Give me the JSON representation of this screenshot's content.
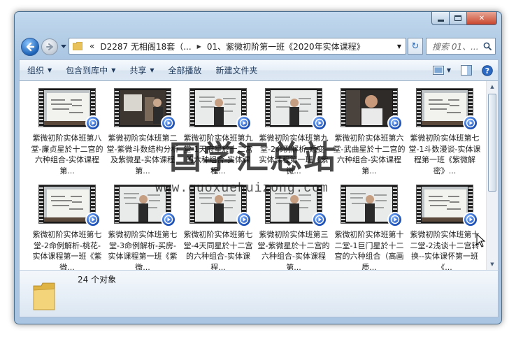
{
  "window": {
    "caption": {
      "minimize": "",
      "maximize": "",
      "close": "✕"
    }
  },
  "nav": {
    "breadcrumbs": [
      {
        "label": "«"
      },
      {
        "label": "D2287 无相阁18套（..."
      },
      {
        "label": "01、紫微初阶第一班《2020年实体课程》"
      }
    ],
    "search_placeholder": "搜索 01、..."
  },
  "toolbar": {
    "organize": "组织",
    "include_in_library": "包含到库中",
    "share": "共享",
    "play_all": "全部播放",
    "new_folder": "新建文件夹"
  },
  "files": [
    {
      "name": "紫微初阶实体班第八堂-廉贞星於十二宫的六种组合-实体课程第...",
      "scene": "board"
    },
    {
      "name": "紫微初阶实体班第二堂-紫微斗数结构分析及紫微星-实体课程第...",
      "scene": "room"
    },
    {
      "name": "紫微初阶实体班第九堂-1天府星於十二宫的六种组合-实体课程...",
      "scene": "board-man"
    },
    {
      "name": "紫微初阶实体班第九堂-2命例解析-婚变-实体课程第一班《紫微...",
      "scene": "board-man"
    },
    {
      "name": "紫微初阶实体班第六堂-武曲星於十二宫的六种组合-实体课程第...",
      "scene": "portrait"
    },
    {
      "name": "紫微初阶实体班第七堂-1斗数漫谈-实体课程第一班《紫微解密》...",
      "scene": "board"
    },
    {
      "name": "紫微初阶实体班第七堂-2命例解析-桃花-实体课程第一班《紫微...",
      "scene": "board"
    },
    {
      "name": "紫微初阶实体班第七堂-3命例解析-买房-实体课程第一班《紫微...",
      "scene": "board-man"
    },
    {
      "name": "紫微初阶实体班第七堂-4天同星於十二宫的六种组合-实体课程...",
      "scene": "board-man"
    },
    {
      "name": "紫微初阶实体班第三堂-紫微星於十二宫的六种组合-实体课程第...",
      "scene": "board-man"
    },
    {
      "name": "紫微初阶实体班第十二堂-1巨门星於十二宫的六种组合（高画质...",
      "scene": "board-man"
    },
    {
      "name": "紫微初阶实体班第十二堂-2浅谈十二宫转换--实体课怀第一班《...",
      "scene": "board"
    }
  ],
  "status": {
    "item_count": "24 个对象"
  },
  "watermark": {
    "title": "国学汇总站",
    "url": "www.guoxuehuizong.com"
  }
}
